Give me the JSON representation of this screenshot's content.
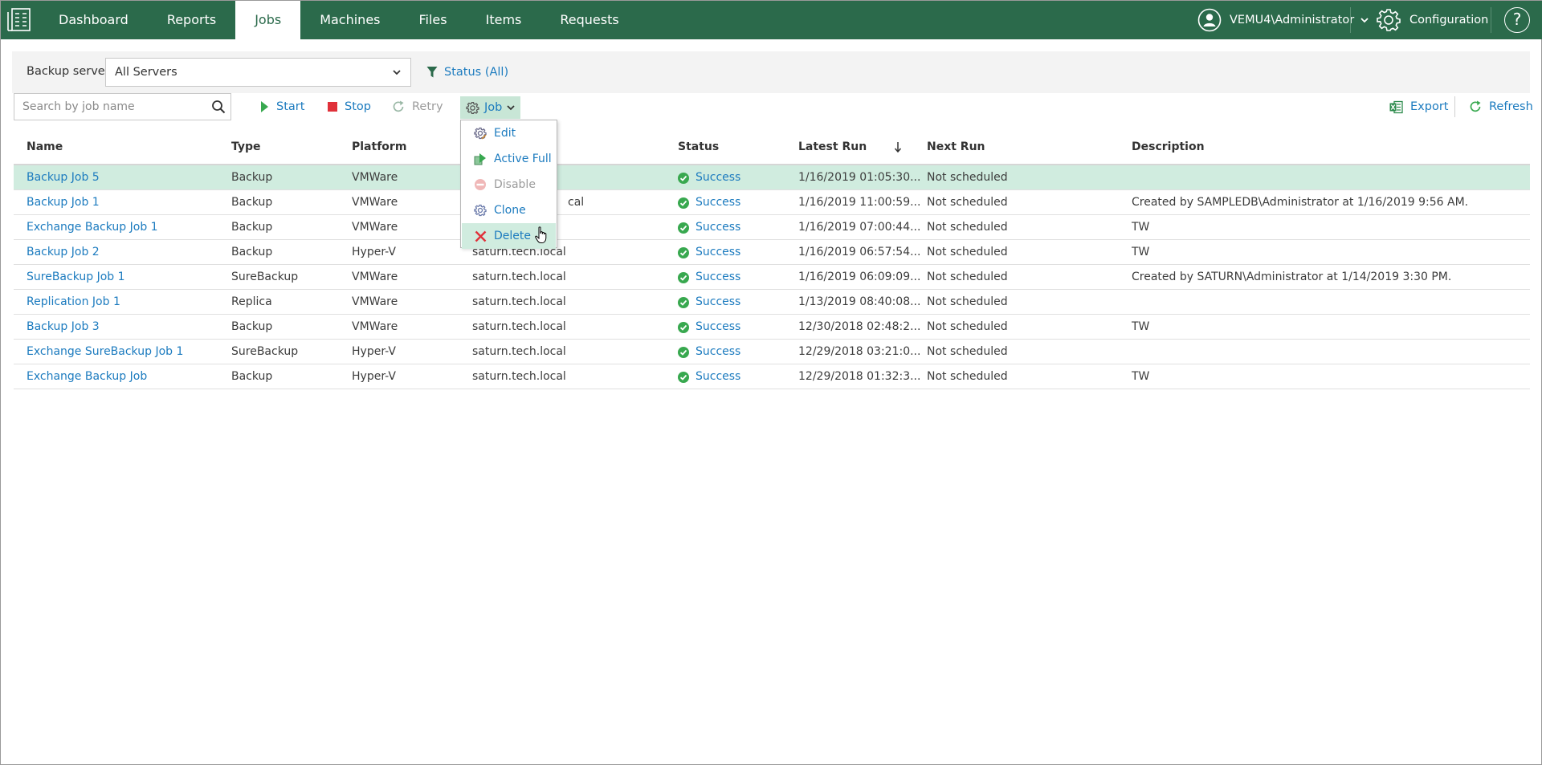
{
  "colors": {
    "brand": "#2b6a4b",
    "link": "#1c7bbf",
    "selected_row": "#d0ecdf",
    "success": "#38a84f",
    "danger": "#e0313a"
  },
  "nav": {
    "items": [
      {
        "label": "Dashboard",
        "active": false
      },
      {
        "label": "Reports",
        "active": false
      },
      {
        "label": "Jobs",
        "active": true
      },
      {
        "label": "Machines",
        "active": false
      },
      {
        "label": "Files",
        "active": false
      },
      {
        "label": "Items",
        "active": false
      },
      {
        "label": "Requests",
        "active": false
      }
    ],
    "user": "VEMU4\\Administrator",
    "configuration": "Configuration",
    "help": "?"
  },
  "filters": {
    "server_label": "Backup server:",
    "server_value": "All Servers",
    "status_filter": "Status (All)"
  },
  "toolbar": {
    "search_placeholder": "Search by job name",
    "start": "Start",
    "stop": "Stop",
    "retry": "Retry",
    "job": "Job",
    "export": "Export",
    "refresh": "Refresh"
  },
  "job_menu": {
    "items": [
      {
        "label": "Edit",
        "icon": "gear-edit-icon",
        "enabled": true
      },
      {
        "label": "Active Full",
        "icon": "active-full-icon",
        "enabled": true
      },
      {
        "label": "Disable",
        "icon": "disable-icon",
        "enabled": false
      },
      {
        "label": "Clone",
        "icon": "clone-icon",
        "enabled": true
      },
      {
        "label": "Delete",
        "icon": "delete-icon",
        "enabled": true,
        "hovered": true
      }
    ]
  },
  "table": {
    "columns": [
      "Name",
      "Type",
      "Platform",
      "Status",
      "Latest Run",
      "Next Run",
      "Description"
    ],
    "rows": [
      {
        "name": "Backup Job 5",
        "type": "Backup",
        "platform": "VMWare",
        "server": "",
        "status": "Success",
        "latest_run": "1/16/2019 01:05:30...",
        "next_run": "Not scheduled",
        "description": "",
        "selected": true
      },
      {
        "name": "Backup Job 1",
        "type": "Backup",
        "platform": "VMWare",
        "server": "cal",
        "status": "Success",
        "latest_run": "1/16/2019 11:00:59...",
        "next_run": "Not scheduled",
        "description": "Created by SAMPLEDB\\Administrator at 1/16/2019 9:56 AM."
      },
      {
        "name": "Exchange Backup Job 1",
        "type": "Backup",
        "platform": "VMWare",
        "server": "",
        "status": "Success",
        "latest_run": "1/16/2019 07:00:44...",
        "next_run": "Not scheduled",
        "description": "TW"
      },
      {
        "name": "Backup Job 2",
        "type": "Backup",
        "platform": "Hyper-V",
        "server": "saturn.tech.local",
        "status": "Success",
        "latest_run": "1/16/2019 06:57:54...",
        "next_run": "Not scheduled",
        "description": "TW"
      },
      {
        "name": "SureBackup Job 1",
        "type": "SureBackup",
        "platform": "VMWare",
        "server": "saturn.tech.local",
        "status": "Success",
        "latest_run": "1/16/2019 06:09:09...",
        "next_run": "Not scheduled",
        "description": "Created by SATURN\\Administrator at 1/14/2019 3:30 PM."
      },
      {
        "name": "Replication Job 1",
        "type": "Replica",
        "platform": "VMWare",
        "server": "saturn.tech.local",
        "status": "Success",
        "latest_run": "1/13/2019 08:40:08...",
        "next_run": "Not scheduled",
        "description": ""
      },
      {
        "name": "Backup Job 3",
        "type": "Backup",
        "platform": "VMWare",
        "server": "saturn.tech.local",
        "status": "Success",
        "latest_run": "12/30/2018 02:48:2...",
        "next_run": "Not scheduled",
        "description": "TW"
      },
      {
        "name": "Exchange SureBackup Job 1",
        "type": "SureBackup",
        "platform": "Hyper-V",
        "server": "saturn.tech.local",
        "status": "Success",
        "latest_run": "12/29/2018 03:21:0...",
        "next_run": "Not scheduled",
        "description": ""
      },
      {
        "name": "Exchange Backup Job",
        "type": "Backup",
        "platform": "Hyper-V",
        "server": "saturn.tech.local",
        "status": "Success",
        "latest_run": "12/29/2018 01:32:3...",
        "next_run": "Not scheduled",
        "description": "TW"
      }
    ]
  }
}
